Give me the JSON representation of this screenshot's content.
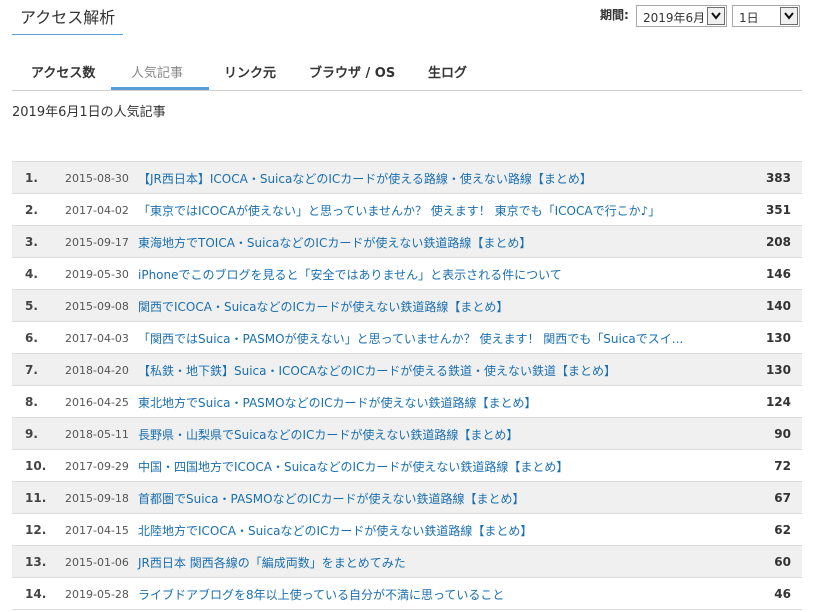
{
  "header": {
    "title": "アクセス解析",
    "period_label": "期間:",
    "month_select": "2019年6月",
    "day_select": "1日"
  },
  "tabs": [
    {
      "label": "アクセス数",
      "active": false
    },
    {
      "label": "人気記事",
      "active": true
    },
    {
      "label": "リンク元",
      "active": false
    },
    {
      "label": "ブラウザ / OS",
      "active": false
    },
    {
      "label": "生ログ",
      "active": false
    }
  ],
  "heading": "2019年6月1日の人気記事",
  "colors": {
    "accent": "#5aa0d8",
    "link": "#1a6fb0",
    "row_alt": "#f0f0f0"
  },
  "ranking": [
    {
      "rank": "1.",
      "date": "2015-08-30",
      "title": "【JR西日本】ICOCA・SuicaなどのICカードが使える路線・使えない路線【まとめ】",
      "count": "383"
    },
    {
      "rank": "2.",
      "date": "2017-04-02",
      "title": "「東京ではICOCAが使えない」と思っていませんか？ 使えます！ 東京でも「ICOCAで行こか♪」",
      "count": "351"
    },
    {
      "rank": "3.",
      "date": "2015-09-17",
      "title": "東海地方でTOICA・SuicaなどのICカードが使えない鉄道路線【まとめ】",
      "count": "208"
    },
    {
      "rank": "4.",
      "date": "2019-05-30",
      "title": "iPhoneでこのブログを見ると「安全ではありません」と表示される件について",
      "count": "146"
    },
    {
      "rank": "5.",
      "date": "2015-09-08",
      "title": "関西でICOCA・SuicaなどのICカードが使えない鉄道路線【まとめ】",
      "count": "140"
    },
    {
      "rank": "6.",
      "date": "2017-04-03",
      "title": "「関西ではSuica・PASMOが使えない」と思っていませんか？ 使えます！ 関西でも「Suicaでスイ...",
      "count": "130"
    },
    {
      "rank": "7.",
      "date": "2018-04-20",
      "title": "【私鉄・地下鉄】Suica・ICOCAなどのICカードが使える鉄道・使えない鉄道【まとめ】",
      "count": "130"
    },
    {
      "rank": "8.",
      "date": "2016-04-25",
      "title": "東北地方でSuica・PASMOなどのICカードが使えない鉄道路線【まとめ】",
      "count": "124"
    },
    {
      "rank": "9.",
      "date": "2018-05-11",
      "title": "長野県・山梨県でSuicaなどのICカードが使えない鉄道路線【まとめ】",
      "count": "90"
    },
    {
      "rank": "10.",
      "date": "2017-09-29",
      "title": "中国・四国地方でICOCA・SuicaなどのICカードが使えない鉄道路線【まとめ】",
      "count": "72"
    },
    {
      "rank": "11.",
      "date": "2015-09-18",
      "title": "首都圏でSuica・PASMOなどのICカードが使えない鉄道路線【まとめ】",
      "count": "67"
    },
    {
      "rank": "12.",
      "date": "2017-04-15",
      "title": "北陸地方でICOCA・SuicaなどのICカードが使えない鉄道路線【まとめ】",
      "count": "62"
    },
    {
      "rank": "13.",
      "date": "2015-01-06",
      "title": "JR西日本 関西各線の「編成両数」をまとめてみた",
      "count": "60"
    },
    {
      "rank": "14.",
      "date": "2019-05-28",
      "title": "ライブドアブログを8年以上使っている自分が不満に思っていること",
      "count": "46"
    }
  ]
}
